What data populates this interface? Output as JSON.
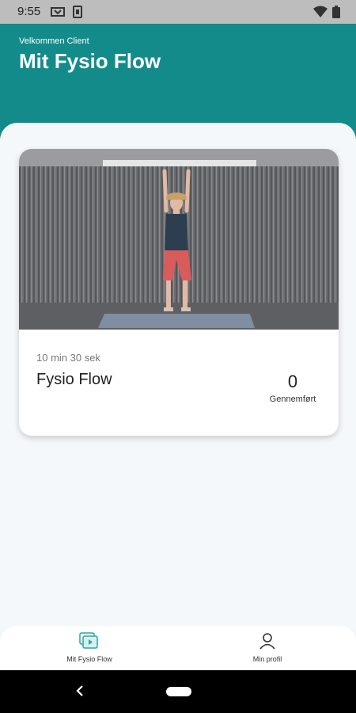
{
  "status_bar": {
    "time": "9:55",
    "icons": [
      "cast-icon",
      "sim-icon",
      "wifi-icon",
      "battery-icon"
    ]
  },
  "header": {
    "welcome": "Velkommen Client",
    "title": "Mit Fysio Flow"
  },
  "card": {
    "duration": "10 min 30 sek",
    "title": "Fysio Flow",
    "count": "0",
    "count_label": "Gennemført"
  },
  "bottom_nav": {
    "items": [
      {
        "label": "Mit Fysio Flow",
        "icon": "video-library-icon"
      },
      {
        "label": "Min profil",
        "icon": "person-icon"
      }
    ]
  },
  "colors": {
    "primary": "#138b8b",
    "background": "#f4f8fb",
    "nav_active_icon": "#2aa6a6"
  }
}
